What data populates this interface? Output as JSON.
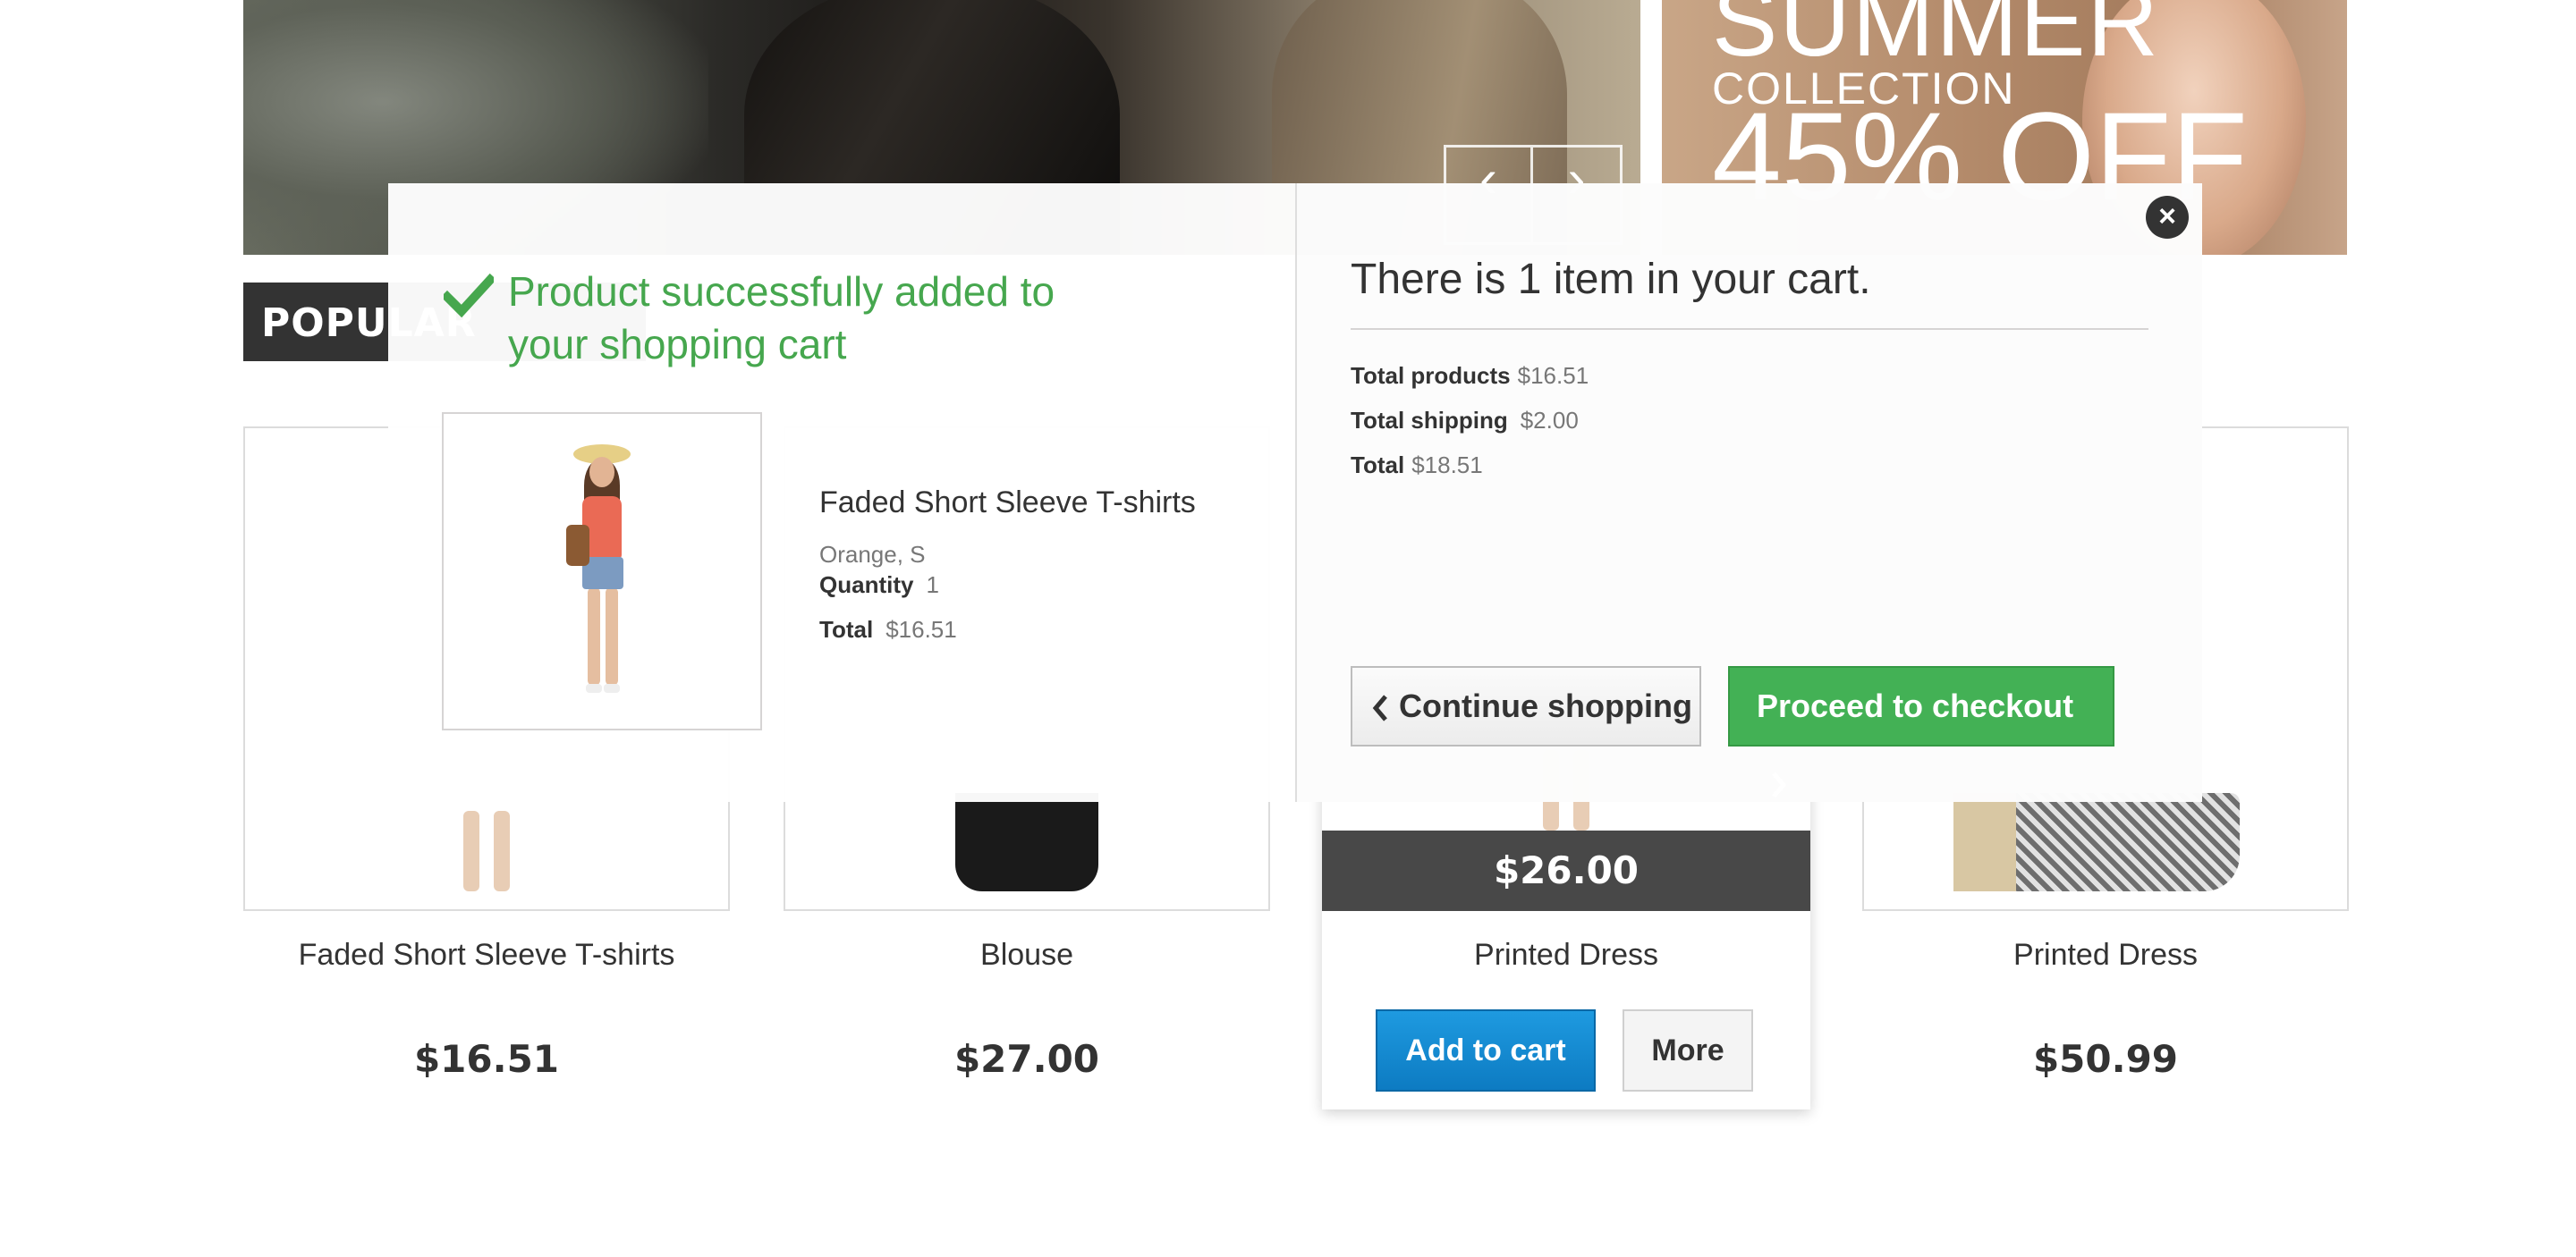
{
  "banner": {
    "promo_title": "SUMMER",
    "promo_sub": "COLLECTION",
    "promo_discount": "45% OFF",
    "prev_arrow": "‹",
    "next_arrow": "›"
  },
  "section_tab": "POPULAR",
  "products": [
    {
      "name": "Faded Short Sleeve T-shirts",
      "price": "$16.51"
    },
    {
      "name": "Blouse",
      "price": "$27.00"
    },
    {
      "name": "Printed Dress",
      "price": "$26.00",
      "add_to_cart": "Add to cart",
      "more": "More"
    },
    {
      "name": "Printed Dress",
      "price": "$50.99"
    }
  ],
  "modal": {
    "success_message": "Product successfully added to your shopping cart",
    "item": {
      "name": "Faded Short Sleeve T-shirts",
      "attributes": "Orange, S",
      "quantity_label": "Quantity",
      "quantity": "1",
      "total_label": "Total",
      "total": "$16.51"
    },
    "cart_count_text": "There is 1 item in your cart.",
    "summary": {
      "products_label": "Total products",
      "products_value": "$16.51",
      "shipping_label": "Total shipping",
      "shipping_value": "$2.00",
      "total_label": "Total",
      "total_value": "$18.51"
    },
    "continue_label": "Continue shopping",
    "checkout_label": "Proceed to checkout",
    "close_glyph": "×"
  },
  "colors": {
    "success_green": "#46a74e",
    "checkout_green": "#43b155",
    "add_blue": "#0d7bc2",
    "dark_bar": "#484848"
  },
  "icons": [
    "check-icon",
    "close-icon",
    "chevron-left-icon",
    "chevron-right-icon"
  ]
}
